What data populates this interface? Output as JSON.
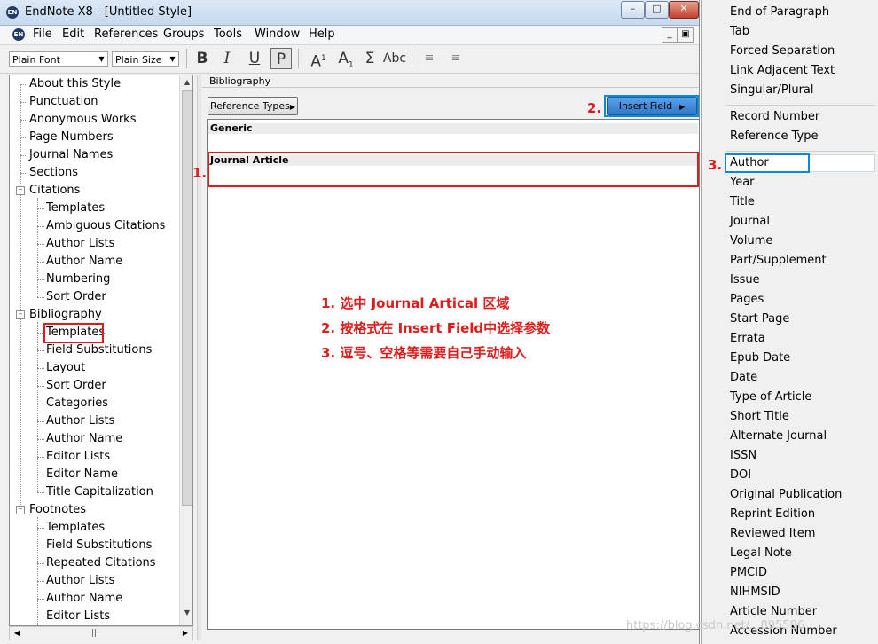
{
  "window": {
    "title": "EndNote X8 - [Untitled Style]",
    "icon_text": "EN"
  },
  "menu": [
    "File",
    "Edit",
    "References",
    "Groups",
    "Tools",
    "Window",
    "Help"
  ],
  "toolbar": {
    "font": "Plain Font",
    "size": "Plain Size",
    "bold": "B",
    "italic": "I",
    "underline": "U",
    "plain": "P",
    "superscript": "A",
    "sup_mark": "1",
    "subscript": "A",
    "sub_mark": "1",
    "sigma": "Σ",
    "smallcaps": "Abc"
  },
  "tree": {
    "top_items": [
      "About this Style",
      "Punctuation",
      "Anonymous Works",
      "Page Numbers",
      "Journal Names",
      "Sections"
    ],
    "citations": {
      "label": "Citations",
      "children": [
        "Templates",
        "Ambiguous Citations",
        "Author Lists",
        "Author Name",
        "Numbering",
        "Sort Order"
      ]
    },
    "bibliography": {
      "label": "Bibliography",
      "children": [
        "Templates",
        "Field Substitutions",
        "Layout",
        "Sort Order",
        "Categories",
        "Author Lists",
        "Author Name",
        "Editor Lists",
        "Editor Name",
        "Title Capitalization"
      ]
    },
    "footnotes": {
      "label": "Footnotes",
      "children": [
        "Templates",
        "Field Substitutions",
        "Repeated Citations",
        "Author Lists",
        "Author Name",
        "Editor Lists"
      ]
    }
  },
  "panel": {
    "title": "Bibliography",
    "reference_types_btn": "Reference Types",
    "insert_field_btn": "Insert Field",
    "sections": [
      "Generic",
      "Journal Article"
    ]
  },
  "annotations": {
    "marker1": "1.",
    "marker2": "2.",
    "marker3": "3.",
    "notes": [
      "1. 选中 Journal Artical 区域",
      "2. 按格式在 Insert Field中选择参数",
      "3. 逗号、空格等需要自己手动输入"
    ]
  },
  "dropdown": {
    "group1": [
      "End of Paragraph",
      "Tab",
      "Forced Separation",
      "Link Adjacent Text",
      "Singular/Plural"
    ],
    "group2": [
      "Record Number",
      "Reference Type"
    ],
    "fields": [
      "Author",
      "Year",
      "Title",
      "Journal",
      "Volume",
      "Part/Supplement",
      "Issue",
      "Pages",
      "Start Page",
      "Errata",
      "Epub Date",
      "Date",
      "Type of Article",
      "Short Title",
      "Alternate Journal",
      "ISSN",
      "DOI",
      "Original Publication",
      "Reprint Edition",
      "Reviewed Item",
      "Legal Note",
      "PMCID",
      "NIHMSID",
      "Article Number",
      "Accession Number"
    ],
    "selected": "Author"
  },
  "watermark": "https://blog.csdn.net/...895586",
  "colors": {
    "annotation_red": "#e11b1b",
    "highlight_blue": "#0b8ad6",
    "insert_btn_blue": "#3f88d8"
  }
}
